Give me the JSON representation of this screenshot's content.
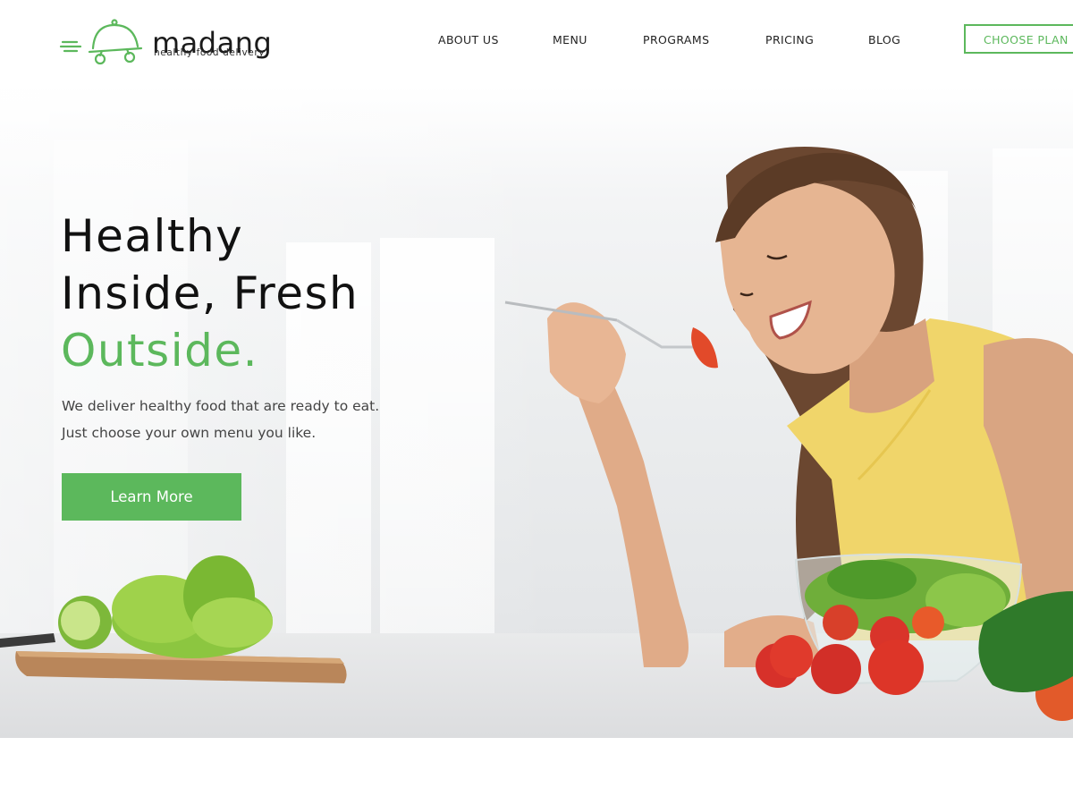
{
  "brand": {
    "name": "madang",
    "tagline": "healthy food delivery",
    "accent_color": "#5cb85c",
    "logo_icon": "serving-cloche-cart-icon"
  },
  "nav": {
    "items": [
      {
        "label": "ABOUT US"
      },
      {
        "label": "MENU"
      },
      {
        "label": "PROGRAMS"
      },
      {
        "label": "PRICING"
      },
      {
        "label": "BLOG"
      }
    ],
    "cta_label": "CHOOSE PLAN"
  },
  "hero": {
    "headline_line1": "Healthy",
    "headline_line2": "Inside, Fresh",
    "headline_line3": "Outside.",
    "lead": "We deliver healthy food that are ready to eat. Just choose your own menu you like.",
    "button_label": "Learn More",
    "image": "woman-eating-salad-photo"
  }
}
